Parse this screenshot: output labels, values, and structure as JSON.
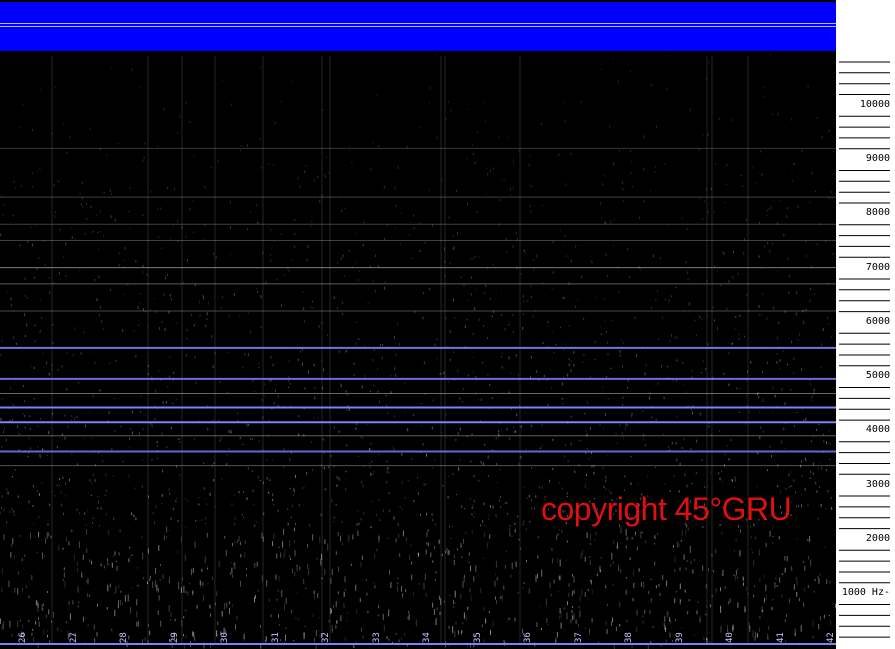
{
  "colors": {
    "band": "#0000ff",
    "band_line": "#b8b8ff",
    "background": "#000000",
    "noise": "#c8c8c8",
    "line_white": "#cfcfcf",
    "line_blue": "#8080ff",
    "watermark": "#e01010",
    "time_label": "#bfc8ff"
  },
  "watermark": "copyright 45°GRU",
  "frequency_axis": {
    "labels": [
      "10000",
      "9000",
      "8000",
      "7000",
      "6000",
      "5000",
      "4000",
      "3000",
      "2000",
      "1000 Hz-"
    ],
    "values": [
      10000,
      9000,
      8000,
      7000,
      6000,
      5000,
      4000,
      3000,
      2000,
      1000
    ],
    "range_hz": [
      0,
      10800
    ]
  },
  "time_axis": {
    "labels": [
      "26",
      "27",
      "28",
      "29",
      "30",
      "31",
      "32",
      "33",
      "34",
      "35",
      "36",
      "37",
      "38",
      "39",
      "40",
      "41",
      "42"
    ]
  },
  "spectral_lines": [
    {
      "freq": 7000,
      "color": "white",
      "strength": 0.6
    },
    {
      "freq": 6700,
      "color": "white",
      "strength": 0.45
    },
    {
      "freq": 6200,
      "color": "white",
      "strength": 0.35
    },
    {
      "freq": 5520,
      "color": "blue",
      "strength": 0.9
    },
    {
      "freq": 4950,
      "color": "blue",
      "strength": 0.85
    },
    {
      "freq": 4680,
      "color": "white",
      "strength": 0.5
    },
    {
      "freq": 4420,
      "color": "blue",
      "strength": 1.0
    },
    {
      "freq": 4150,
      "color": "blue",
      "strength": 1.0
    },
    {
      "freq": 3900,
      "color": "white",
      "strength": 0.45
    },
    {
      "freq": 3610,
      "color": "blue",
      "strength": 0.8
    },
    {
      "freq": 3350,
      "color": "white",
      "strength": 0.4
    },
    {
      "freq": 8300,
      "color": "white",
      "strength": 0.3
    },
    {
      "freq": 7800,
      "color": "white",
      "strength": 0.3
    },
    {
      "freq": 7500,
      "color": "white",
      "strength": 0.3
    },
    {
      "freq": 9200,
      "color": "white",
      "strength": 0.25
    }
  ]
}
